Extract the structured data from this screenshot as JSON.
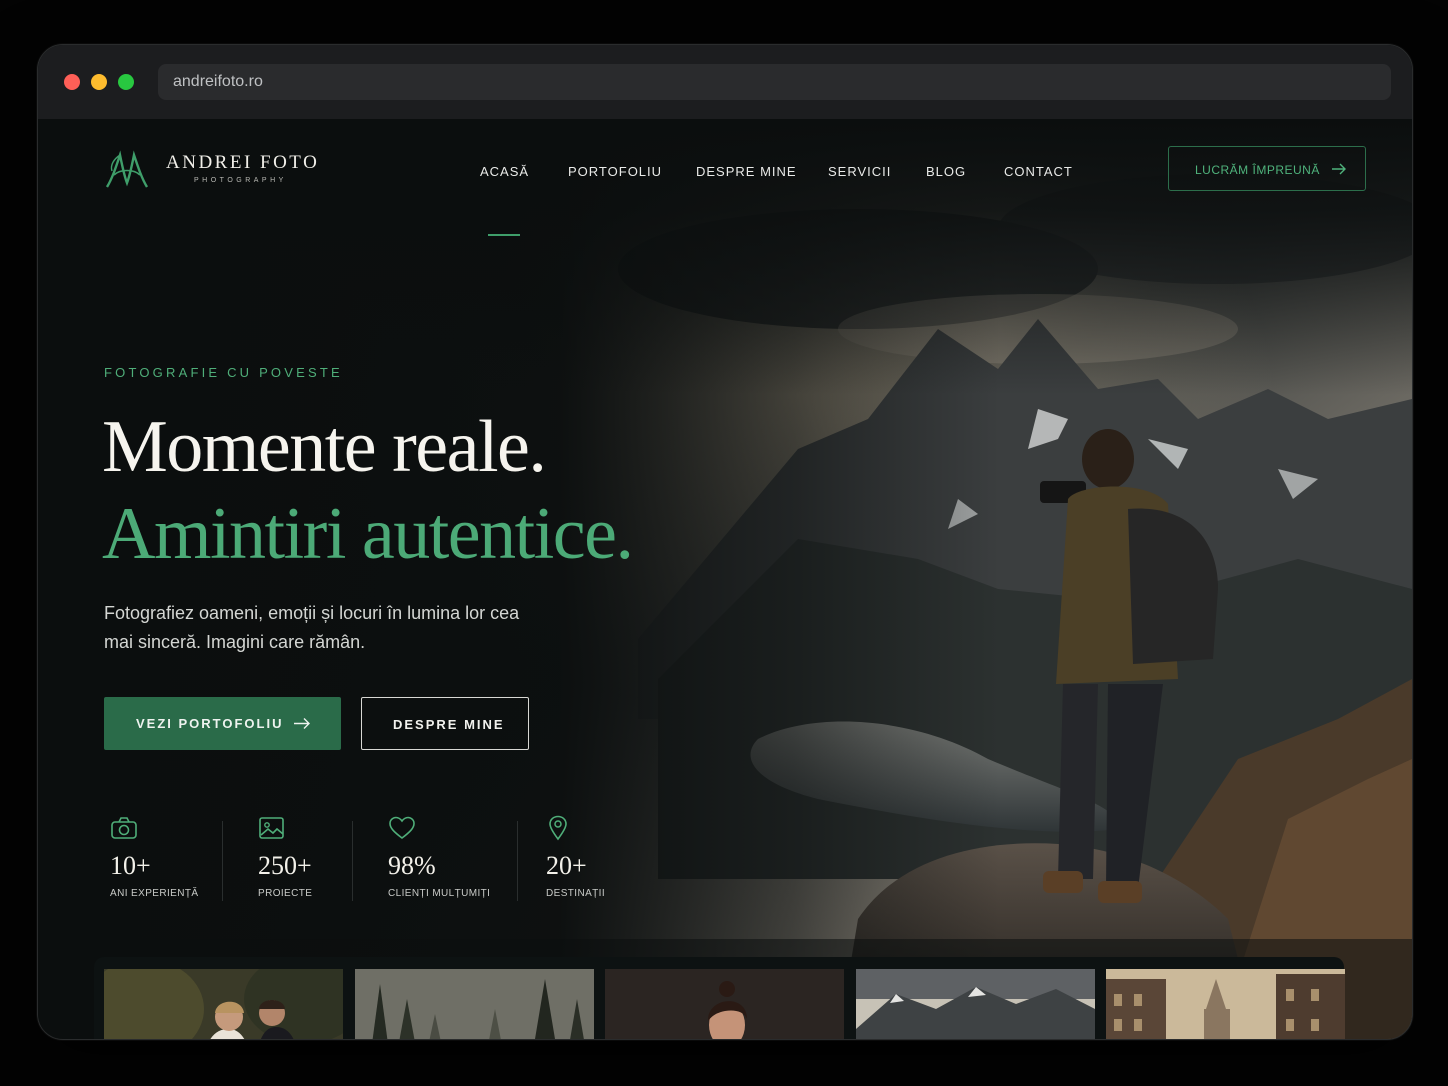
{
  "browser": {
    "url": "andreifoto.ro"
  },
  "brand": {
    "name": "ANDREI FOTO",
    "tagline": "PHOTOGRAPHY",
    "accent_color": "#4caa77",
    "logo_icon": "monogram-am-logo"
  },
  "nav": {
    "items": [
      {
        "label": "ACASĂ",
        "active": true
      },
      {
        "label": "PORTOFOLIU",
        "active": false
      },
      {
        "label": "DESPRE MINE",
        "active": false
      },
      {
        "label": "SERVICII",
        "active": false
      },
      {
        "label": "BLOG",
        "active": false
      },
      {
        "label": "CONTACT",
        "active": false
      }
    ],
    "cta": "LUCRĂM ÎMPREUNĂ"
  },
  "hero": {
    "eyebrow": "FOTOGRAFIE CU POVESTE",
    "headline_line1": "Momente reale.",
    "headline_line2": "Amintiri autentice.",
    "lead": "Fotografiez oameni, emoții și locuri în lumina lor cea mai sinceră. Imagini care rămân.",
    "primary_button": "VEZI PORTOFOLIU",
    "secondary_button": "DESPRE MINE"
  },
  "stats": [
    {
      "icon": "camera-icon",
      "value": "10+",
      "label": "ANI EXPERIENȚĂ"
    },
    {
      "icon": "image-icon",
      "value": "250+",
      "label": "PROIECTE"
    },
    {
      "icon": "heart-icon",
      "value": "98%",
      "label": "CLIENȚI MULȚUMIȚI"
    },
    {
      "icon": "location-pin-icon",
      "value": "20+",
      "label": "DESTINAȚII"
    }
  ],
  "gallery": [
    {
      "subject": "wedding-couple"
    },
    {
      "subject": "misty-forest"
    },
    {
      "subject": "woman-portrait"
    },
    {
      "subject": "mountain-lake"
    },
    {
      "subject": "old-city-street"
    }
  ]
}
